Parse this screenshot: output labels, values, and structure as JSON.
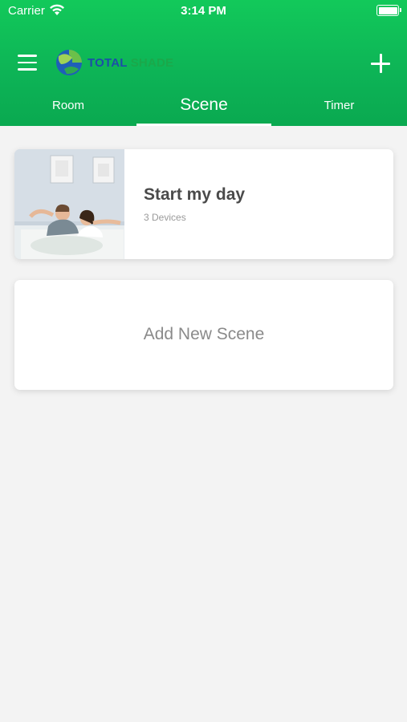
{
  "status_bar": {
    "carrier": "Carrier",
    "time": "3:14 PM"
  },
  "header": {
    "logo": {
      "word1": "TOTAL",
      "word2": "SHADE"
    },
    "icons": {
      "menu": "hamburger-menu-icon",
      "add": "plus-icon"
    },
    "accent_color": "#0db356"
  },
  "tabs": [
    {
      "label": "Room",
      "active": false
    },
    {
      "label": "Scene",
      "active": true
    },
    {
      "label": "Timer",
      "active": false
    }
  ],
  "scenes": [
    {
      "title": "Start my day",
      "subtitle": "3 Devices",
      "image": "couple-waking-up-in-bed-photo"
    }
  ],
  "add_scene": {
    "label": "Add New Scene"
  }
}
